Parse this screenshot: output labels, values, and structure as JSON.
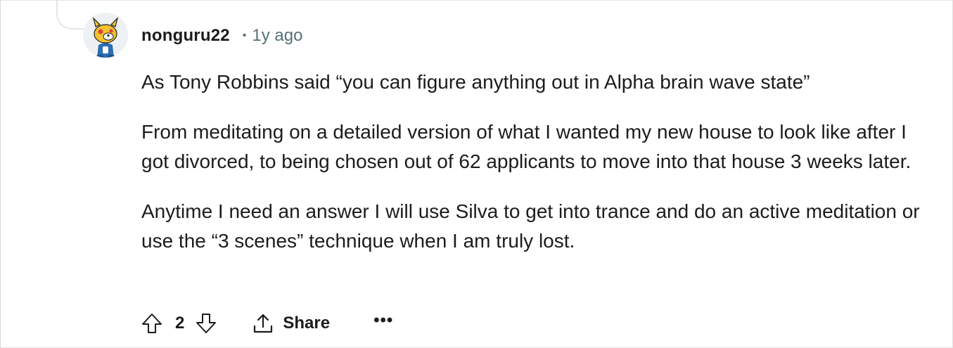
{
  "comment": {
    "username": "nonguru22",
    "separator": "•",
    "timestamp": "1y ago",
    "paragraphs": [
      "As Tony Robbins said “you can figure anything out in Alpha brain wave state”",
      "From meditating on a detailed version of what I wanted my new house to look like after I got divorced, to being chosen out of 62 applicants to move into that house 3 weeks later.",
      "Anytime I need an answer I will use Silva to get into trance and do an active meditation or use the “3 scenes” technique when I am truly lost."
    ]
  },
  "actions": {
    "upvote_icon": "arrow-up-outline-icon",
    "score": "2",
    "downvote_icon": "arrow-down-outline-icon",
    "share_icon": "share-upload-icon",
    "share_label": "Share",
    "more_label": "•••"
  },
  "colors": {
    "text": "#1c1c1c",
    "meta": "#576f76",
    "border": "#e3e3e3"
  }
}
